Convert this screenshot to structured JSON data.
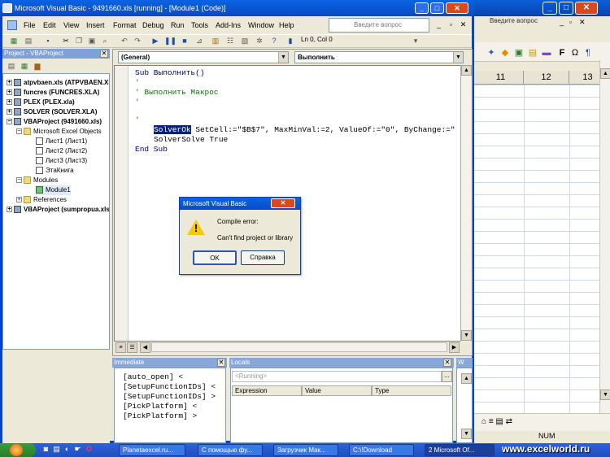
{
  "vbe": {
    "title": "Microsoft Visual Basic - 9491660.xls [running] - [Module1 (Code)]",
    "menu": [
      "File",
      "Edit",
      "View",
      "Insert",
      "Format",
      "Debug",
      "Run",
      "Tools",
      "Add-Ins",
      "Window",
      "Help"
    ],
    "help_placeholder": "Введите вопрос",
    "position": "Ln 0, Col 0"
  },
  "excel": {
    "help_placeholder": "Введите вопрос",
    "columns": [
      "11",
      "12",
      "13"
    ],
    "status": "NUM"
  },
  "project": {
    "title": "Project - VBAProject",
    "items": [
      "atpvbaen.xls (ATPVBAEN.XLA)",
      "funcres (FUNCRES.XLA)",
      "PLEX (PLEX.xla)",
      "SOLVER (SOLVER.XLA)",
      "VBAProject (9491660.xls)",
      "Microsoft Excel Objects",
      "Лист1 (Лист1)",
      "Лист2 (Лист2)",
      "Лист3 (Лист3)",
      "ЭтаКнига",
      "Modules",
      "Module1",
      "References",
      "VBAProject (sumpropua.xls)"
    ]
  },
  "code": {
    "object_combo": "(General)",
    "proc_combo": "Выполнить",
    "lines": {
      "l1": "Sub Выполнить()",
      "l2": "'",
      "l3": "' Выполнить Макрос",
      "l4": "'",
      "l5": "'",
      "l6a": "SolverOk",
      "l6b": " SetCell:=\"$B$7\", MaxMinVal:=2, ValueOf:=\"0\", ByChange:=\"",
      "l7": "SolverSolve True",
      "l8": "End Sub"
    }
  },
  "immediate": {
    "title": "Immediate",
    "lines": [
      "[auto_open] <",
      "[SetupFunctionIDs] <",
      "[SetupFunctionIDs] >",
      "[PickPlatform] <",
      "[PickPlatform] >"
    ]
  },
  "locals": {
    "title": "Locals",
    "running": "<Running>",
    "headers": [
      "Expression",
      "Value",
      "Type"
    ]
  },
  "watches": {
    "title": "W"
  },
  "dialog": {
    "title": "Microsoft Visual Basic",
    "message1": "Compile error:",
    "message2": "Can't find project or library",
    "ok": "OK",
    "help": "Справка"
  },
  "taskbar": {
    "items": [
      "Planetaexcel.ru...",
      "С помощью фу...",
      "Загрузчик Мак...",
      "C:\\!Download",
      "2 Microsoft Of..."
    ]
  },
  "watermark": "www.excelworld.ru"
}
